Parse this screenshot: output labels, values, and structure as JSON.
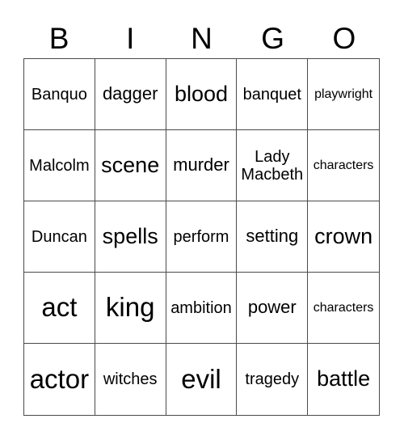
{
  "header": {
    "letters": [
      "B",
      "I",
      "N",
      "G",
      "O"
    ]
  },
  "cells": [
    {
      "text": "Banquo",
      "size": "s-sm"
    },
    {
      "text": "dagger",
      "size": "s-md"
    },
    {
      "text": "blood",
      "size": "s-lg"
    },
    {
      "text": "banquet",
      "size": "s-sm"
    },
    {
      "text": "playwright",
      "size": "s-xs"
    },
    {
      "text": "Malcolm",
      "size": "s-sm"
    },
    {
      "text": "scene",
      "size": "s-lg"
    },
    {
      "text": "murder",
      "size": "s-md"
    },
    {
      "text": "Lady Macbeth",
      "size": "s-sm"
    },
    {
      "text": "characters",
      "size": "s-xs"
    },
    {
      "text": "Duncan",
      "size": "s-sm"
    },
    {
      "text": "spells",
      "size": "s-lg"
    },
    {
      "text": "perform",
      "size": "s-sm"
    },
    {
      "text": "setting",
      "size": "s-md"
    },
    {
      "text": "crown",
      "size": "s-lg"
    },
    {
      "text": "act",
      "size": "s-xl"
    },
    {
      "text": "king",
      "size": "s-xl"
    },
    {
      "text": "ambition",
      "size": "s-sm"
    },
    {
      "text": "power",
      "size": "s-md"
    },
    {
      "text": "characters",
      "size": "s-xs"
    },
    {
      "text": "actor",
      "size": "s-xl"
    },
    {
      "text": "witches",
      "size": "s-sm"
    },
    {
      "text": "evil",
      "size": "s-xl"
    },
    {
      "text": "tragedy",
      "size": "s-sm"
    },
    {
      "text": "battle",
      "size": "s-lg"
    }
  ]
}
